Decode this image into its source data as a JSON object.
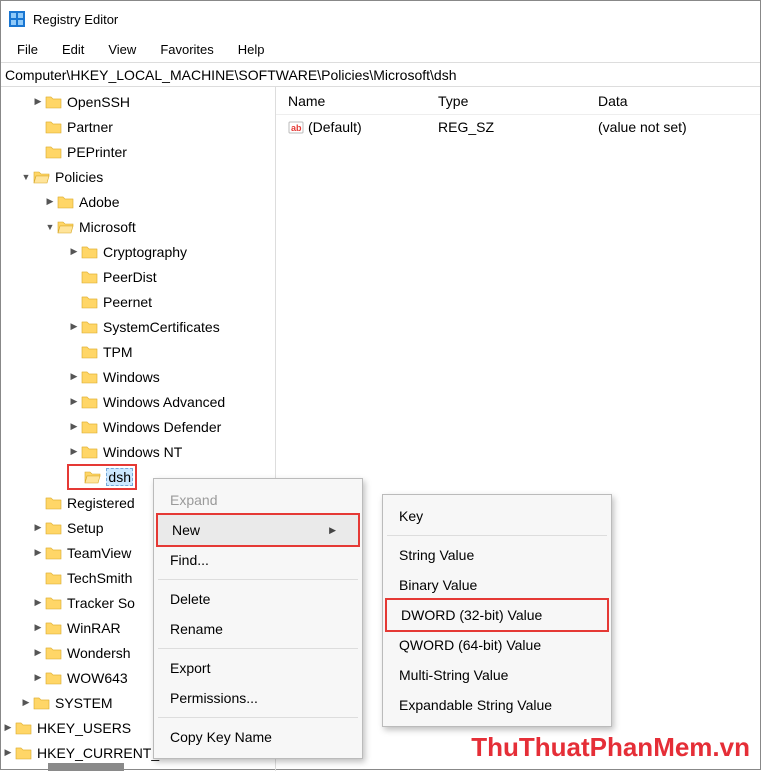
{
  "window": {
    "title": "Registry Editor"
  },
  "menu": {
    "file": "File",
    "edit": "Edit",
    "view": "View",
    "favorites": "Favorites",
    "help": "Help"
  },
  "address": "Computer\\HKEY_LOCAL_MACHINE\\SOFTWARE\\Policies\\Microsoft\\dsh",
  "tree": {
    "openssh": "OpenSSH",
    "partner": "Partner",
    "peprinter": "PEPrinter",
    "policies": "Policies",
    "adobe": "Adobe",
    "microsoft": "Microsoft",
    "cryptography": "Cryptography",
    "peerdist": "PeerDist",
    "peernet": "Peernet",
    "syscerts": "SystemCertificates",
    "tpm": "TPM",
    "windows": "Windows",
    "winadv": "Windows Advanced",
    "windef": "Windows Defender",
    "winnt": "Windows NT",
    "dsh": "dsh",
    "registered": "Registered",
    "setup": "Setup",
    "teamview": "TeamView",
    "techsmith": "TechSmith",
    "tracker": "Tracker So",
    "winrar": "WinRAR",
    "wondersh": "Wondersh",
    "wow643": "WOW643",
    "system": "SYSTEM",
    "hkusers": "HKEY_USERS",
    "hkcc": "HKEY_CURRENT_CONFIG"
  },
  "list": {
    "headers": {
      "name": "Name",
      "type": "Type",
      "data": "Data"
    },
    "rows": [
      {
        "name": "(Default)",
        "type": "REG_SZ",
        "data": "(value not set)"
      }
    ]
  },
  "ctx1": {
    "expand": "Expand",
    "new": "New",
    "find": "Find...",
    "delete": "Delete",
    "rename": "Rename",
    "export": "Export",
    "permissions": "Permissions...",
    "copykey": "Copy Key Name"
  },
  "ctx2": {
    "key": "Key",
    "string": "String Value",
    "binary": "Binary Value",
    "dword": "DWORD (32-bit) Value",
    "qword": "QWORD (64-bit) Value",
    "multi": "Multi-String Value",
    "exp": "Expandable String Value"
  },
  "watermark": "ThuThuatPhanMem.vn"
}
